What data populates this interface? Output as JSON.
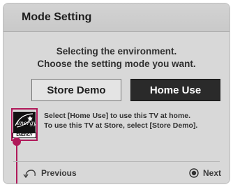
{
  "dialog": {
    "title": "Mode Setting",
    "message": {
      "line1": "Selecting the environment.",
      "line2": "Choose the setting mode you want."
    },
    "buttons": {
      "store_demo": "Store Demo",
      "home_use": "Home Use"
    },
    "energy_star_logo": {
      "script_text": "energy",
      "label": "ENERGY STAR"
    },
    "info": {
      "line1": "Select [Home Use] to use this TV at home.",
      "line2": "To use this TV at Store, select [Store Demo]."
    },
    "nav": {
      "previous_label": "Previous",
      "previous_icon": "back-arrow-icon",
      "next_label": "Next",
      "next_icon": "ok-button-icon"
    }
  },
  "colors": {
    "dialog_background": "#d8d8d8",
    "selected_button": "#2a2a2a",
    "highlight_accent": "#b0195a"
  }
}
